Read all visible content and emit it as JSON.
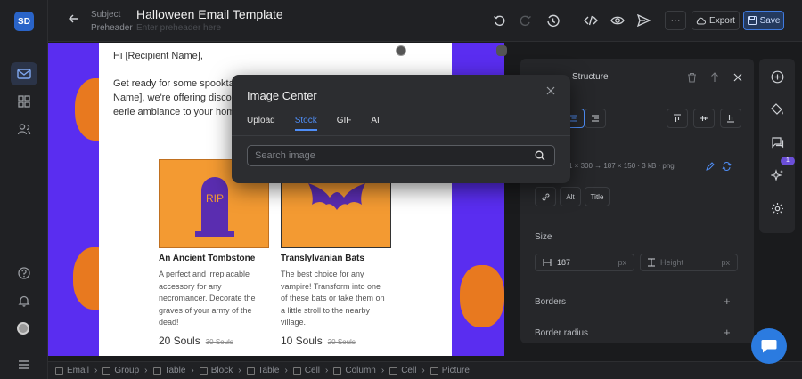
{
  "app": {
    "initials": "SD"
  },
  "header": {
    "subject_label": "Subject",
    "subject_value": "Halloween Email Template",
    "preheader_label": "Preheader",
    "preheader_placeholder": "Enter preheader here",
    "export_label": "Export",
    "save_label": "Save"
  },
  "email": {
    "greeting": "Hi [Recipient Name],",
    "intro_line1": "Get ready for some spooktac",
    "intro_line2": "Name], we're offering discou",
    "intro_line3": "eerie ambiance to your home",
    "products": [
      {
        "image_text": "RIP",
        "name": "An Ancient Tombstone",
        "desc_lines": [
          "A perfect and irreplacable",
          "accessory for any",
          "necromancer. Decorate the",
          "graves of your army of the",
          "dead!"
        ],
        "price": "20 Souls",
        "old_price": "30 Souls"
      },
      {
        "image_text": "",
        "name": "Translylvanian Bats",
        "desc_lines": [
          "The best choice for any",
          "vampire! Transform into one",
          "of these bats or take them on",
          "a little stroll to the nearby",
          "village."
        ],
        "price": "10 Souls",
        "old_price": "20 Souls"
      }
    ]
  },
  "panel": {
    "title": "Structure",
    "image_info": "1 × 300 → 187 × 150 · 3 kB · png",
    "alt_label": "Alt",
    "title_label": "Title",
    "size_label": "Size",
    "width_value": "187",
    "width_unit": "px",
    "height_placeholder": "Height",
    "height_unit": "px",
    "borders_label": "Borders",
    "border_radius_label": "Border radius"
  },
  "breadcrumb": [
    "Email",
    "Group",
    "Table",
    "Block",
    "Table",
    "Cell",
    "Column",
    "Cell",
    "Picture"
  ],
  "modal": {
    "title": "Image Center",
    "tabs": [
      "Upload",
      "Stock",
      "GIF",
      "AI"
    ],
    "active_tab": "Stock",
    "search_placeholder": "Search image"
  },
  "right_col": {
    "badge_count": "1"
  },
  "colors": {
    "accent": "#4f8ef7",
    "canvas_bg": "#5a2df0",
    "product_orange": "#f39a32",
    "tombstone": "#5a2db0"
  }
}
